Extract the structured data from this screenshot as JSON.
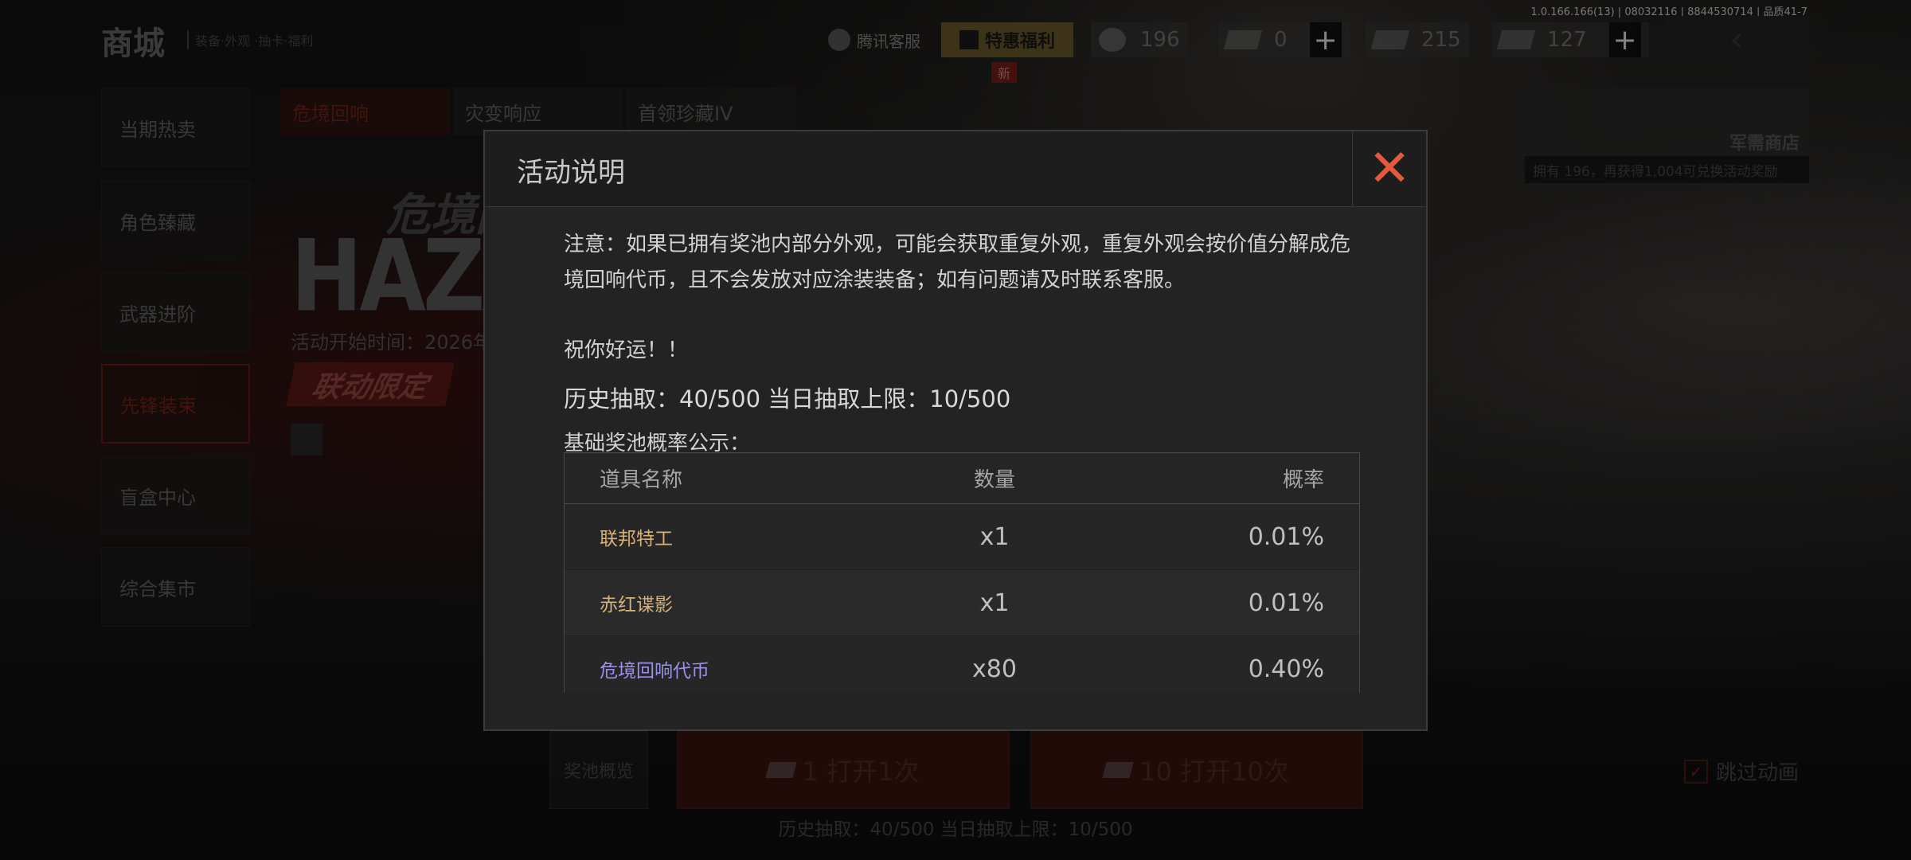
{
  "version": "1.0.166.166(13) | 08032116 | 8844530714 | 品质41-7",
  "header": {
    "title": "商城",
    "subtitle": "装备·外观 ·抽卡·福利",
    "service_label": "腾讯客服",
    "welfare_label": "特惠福利",
    "new_tag": "新",
    "currencies": [
      {
        "name": "coin-icon",
        "value": "196"
      },
      {
        "name": "ticket-icon",
        "value": "0"
      },
      {
        "name": "voucher-icon",
        "value": "215"
      },
      {
        "name": "card-icon",
        "value": "127"
      }
    ],
    "plus": "+",
    "back": "‹"
  },
  "sidebar": {
    "items": [
      {
        "label": "当期热卖"
      },
      {
        "label": "角色臻藏"
      },
      {
        "label": "武器进阶"
      },
      {
        "label": "先锋装束",
        "active": true
      },
      {
        "label": "盲盒中心"
      },
      {
        "label": "综合集市"
      }
    ]
  },
  "tabs": [
    {
      "label": "危境回响",
      "active": true
    },
    {
      "label": "灾变响应"
    },
    {
      "label": "首领珍藏IV"
    }
  ],
  "banner": {
    "title_cn": "危境回响",
    "title_en": "HAZARD",
    "start_time": "活动开始时间：2026年",
    "collab": "联动限定"
  },
  "military_shop": {
    "title": "军需商店",
    "note": "拥有 196，再获得1,004可兑换活动奖励"
  },
  "bottom": {
    "pool_overview": "奖池概览",
    "open1_label": "1  打开1次",
    "open10_label": "10  打开10次",
    "stats": "历史抽取：40/500  当日抽取上限：10/500",
    "skip": "跳过动画",
    "skip_check": "✓"
  },
  "modal": {
    "title": "活动说明",
    "close": "✕",
    "notice": "注意：如果已拥有奖池内部分外观，可能会获取重复外观，重复外观会按价值分解成危境回响代币，且不会发放对应涂装装备；如有问题请及时联系客服。",
    "luck": "祝你好运！！",
    "stats": "历史抽取：40/500  当日抽取上限：10/500",
    "prob_label": "基础奖池概率公示：",
    "table": {
      "headers": [
        "道具名称",
        "数量",
        "概率"
      ],
      "rows": [
        {
          "name": "联邦特工",
          "qty": "x1",
          "rate": "0.01%",
          "tier": "gold"
        },
        {
          "name": "赤红谍影",
          "qty": "x1",
          "rate": "0.01%",
          "tier": "gold"
        },
        {
          "name": "危境回响代币",
          "qty": "x80",
          "rate": "0.40%",
          "tier": "purple"
        }
      ]
    }
  }
}
